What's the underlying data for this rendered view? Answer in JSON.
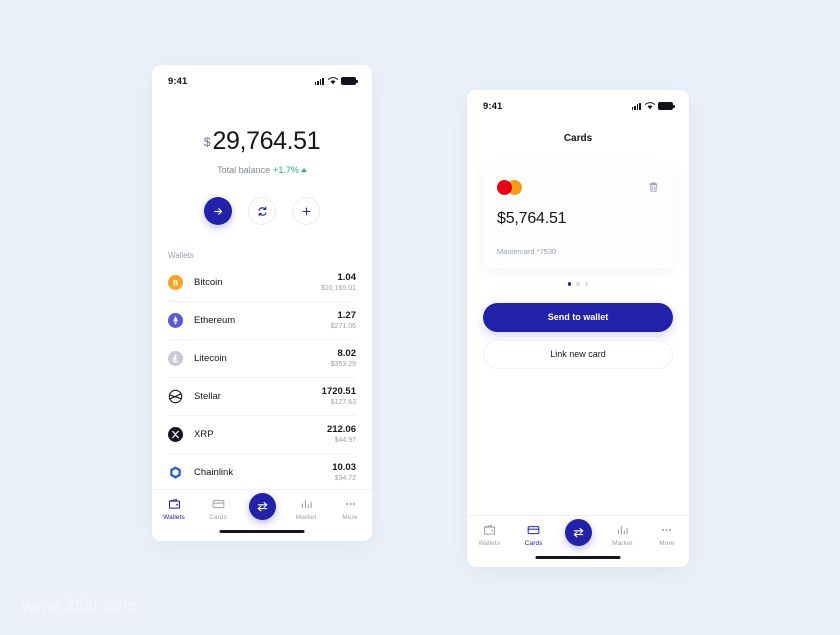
{
  "background_color": "#ebf1fa",
  "accent_color": "#2222a8",
  "positive_color": "#23b187",
  "watermark": "www.25xt.com",
  "phone_wallets": {
    "status_bar": {
      "time": "9:41",
      "signal_icon": "cellular-bars-icon",
      "wifi_icon": "wifi-icon",
      "battery_icon": "battery-full-icon"
    },
    "balance": {
      "currency_symbol": "$",
      "amount": "29,764.51",
      "label": "Total balance",
      "change": "+1.7%",
      "trend_icon": "caret-up-icon"
    },
    "actions": [
      {
        "name": "send-button",
        "icon": "arrow-right-icon",
        "style": "primary"
      },
      {
        "name": "exchange-button",
        "icon": "refresh-icon",
        "style": "ghost"
      },
      {
        "name": "add-button",
        "icon": "plus-icon",
        "style": "ghost"
      }
    ],
    "wallets_section_label": "Wallets",
    "wallets": [
      {
        "name": "Bitcoin",
        "icon": "bitcoin-icon",
        "amount": "1.04",
        "usd": "$10,165.01"
      },
      {
        "name": "Ethereum",
        "icon": "ethereum-icon",
        "amount": "1.27",
        "usd": "$271.06"
      },
      {
        "name": "Litecoin",
        "icon": "litecoin-icon",
        "amount": "8.02",
        "usd": "$353.29"
      },
      {
        "name": "Stellar",
        "icon": "stellar-icon",
        "amount": "1720.51",
        "usd": "$127.63"
      },
      {
        "name": "XRP",
        "icon": "xrp-icon",
        "amount": "212.06",
        "usd": "$44.97"
      },
      {
        "name": "Chainlink",
        "icon": "chainlink-icon",
        "amount": "10.03",
        "usd": "$34.72"
      }
    ],
    "tabs": [
      {
        "label": "Wallets",
        "icon": "wallet-icon",
        "active": true
      },
      {
        "label": "Cards",
        "icon": "card-icon",
        "active": false
      },
      {
        "label": "",
        "icon": "exchange-icon",
        "fab": true
      },
      {
        "label": "Market",
        "icon": "bar-chart-icon",
        "active": false
      },
      {
        "label": "More",
        "icon": "ellipsis-icon",
        "active": false
      }
    ]
  },
  "phone_cards": {
    "status_bar": {
      "time": "9:41",
      "signal_icon": "cellular-bars-icon",
      "wifi_icon": "wifi-icon",
      "battery_icon": "battery-full-icon"
    },
    "title": "Cards",
    "card": {
      "brand_icon": "mastercard-icon",
      "delete_icon": "trash-icon",
      "amount": "$5,764.51",
      "meta": "Mastercard *7530"
    },
    "pagination": {
      "count": 3,
      "active_index": 0
    },
    "primary_button": "Send to wallet",
    "secondary_button": "Link new card",
    "tabs": [
      {
        "label": "Wallets",
        "icon": "wallet-icon",
        "active": false
      },
      {
        "label": "Cards",
        "icon": "card-icon",
        "active": true
      },
      {
        "label": "",
        "icon": "exchange-icon",
        "fab": true
      },
      {
        "label": "Market",
        "icon": "bar-chart-icon",
        "active": false
      },
      {
        "label": "More",
        "icon": "ellipsis-icon",
        "active": false
      }
    ]
  }
}
